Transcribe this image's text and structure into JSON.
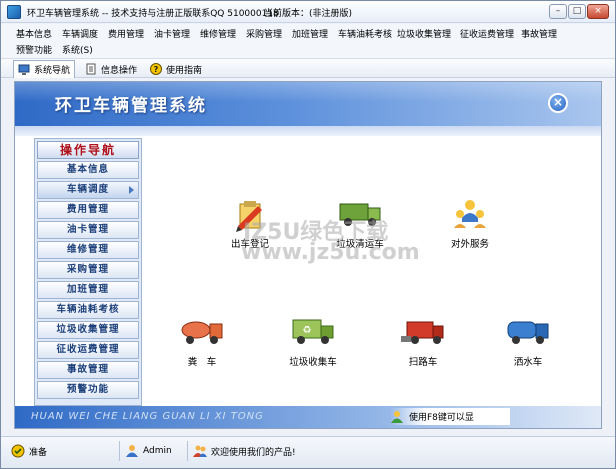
{
  "window": {
    "title": "环卫车辆管理系统 -- 技术支持与注册正版联系QQ 510000118",
    "version_label": "当前版本：(非注册版)",
    "controls": [
      "–",
      "□",
      "×"
    ]
  },
  "menu": {
    "row1": [
      "基本信息",
      "车辆调度",
      "费用管理",
      "油卡管理",
      "维修管理",
      "采购管理",
      "加班管理",
      "车辆油耗考核",
      "垃圾收集管理",
      "征收运费管理",
      "事故管理"
    ],
    "row2": [
      "预警功能",
      "系统(S)"
    ]
  },
  "toolbar": {
    "items": [
      "系统导航",
      "信息操作",
      "使用指南"
    ]
  },
  "banner": {
    "title": "环卫车辆管理系统"
  },
  "nav": {
    "heading": "操作导航",
    "items": [
      "基本信息",
      "车辆调度",
      "费用管理",
      "油卡管理",
      "维修管理",
      "采购管理",
      "加班管理",
      "车辆油耗考核",
      "垃圾收集管理",
      "征收运费管理",
      "事故管理",
      "预警功能"
    ],
    "selected": "车辆调度"
  },
  "functions": {
    "items": [
      "出车登记",
      "垃圾清运车",
      "对外服务",
      "粪　车",
      "垃圾收集车",
      "扫路车",
      "洒水车"
    ]
  },
  "footer": {
    "pinyin": "HUAN WEI CHE LIANG GUAN LI XI TONG",
    "tip": "使用F8键可以显"
  },
  "status": {
    "state": "准备",
    "user": "Admin",
    "welcome": "欢迎使用我们的产品!"
  },
  "watermark": {
    "line1": "JZ5U绿色下载",
    "line2": "www.jz5u.com"
  }
}
